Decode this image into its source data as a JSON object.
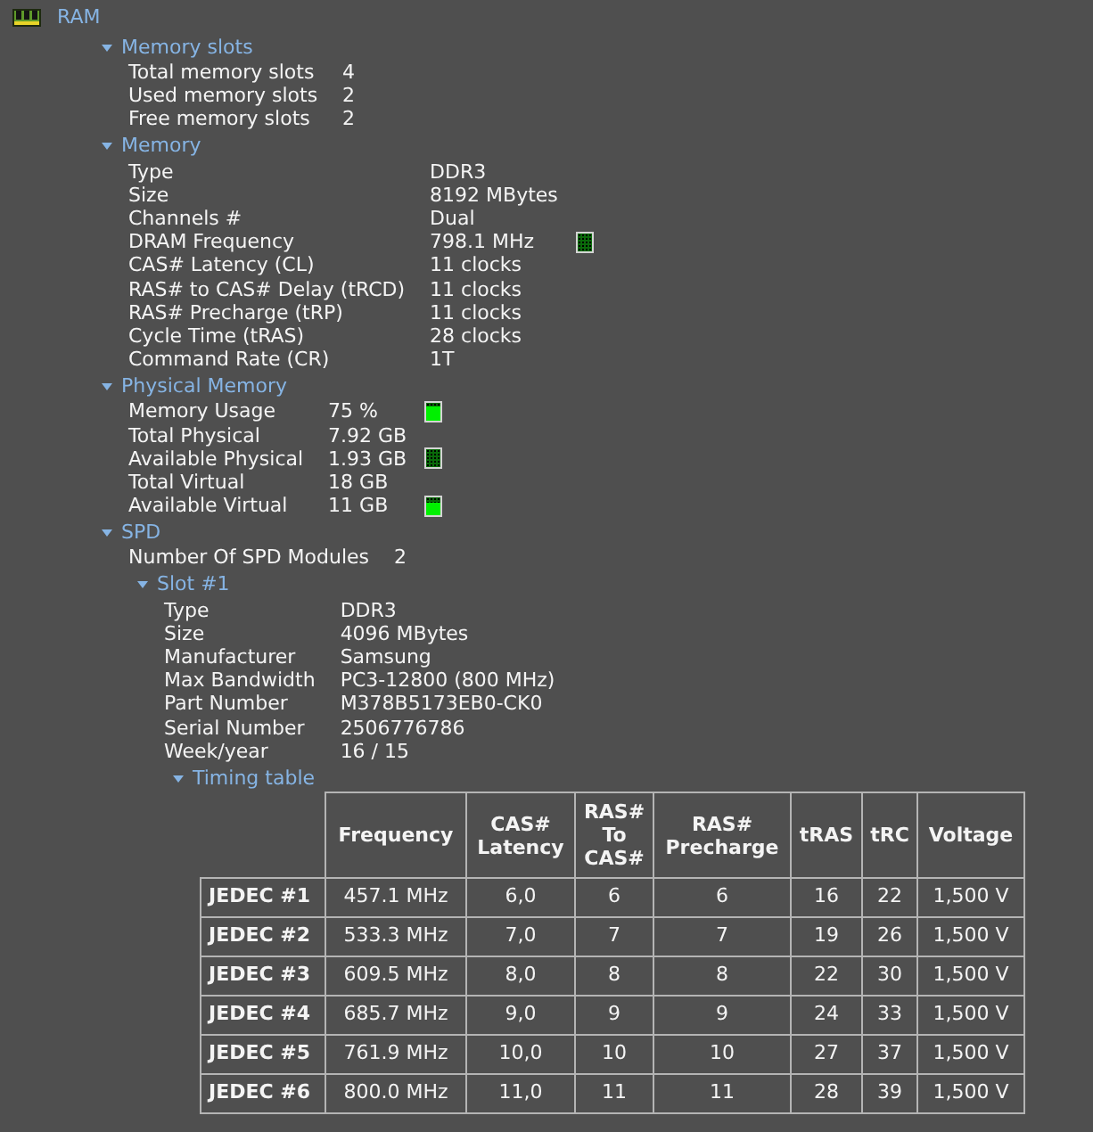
{
  "tree": {
    "label": "RAM",
    "sections": [
      {
        "title": "Memory slots",
        "expanded": true,
        "rows": [
          {
            "label": "Total memory slots",
            "value": "4"
          },
          {
            "label": "Used memory slots",
            "value": "2"
          },
          {
            "label": "Free memory slots",
            "value": "2"
          }
        ]
      },
      {
        "title": "Memory",
        "expanded": true,
        "rows": [
          {
            "label": "Type",
            "value": "DDR3"
          },
          {
            "label": "Size",
            "value": "8192 MBytes"
          },
          {
            "label": "Channels #",
            "value": "Dual"
          },
          {
            "label": "DRAM Frequency",
            "value": "798.1 MHz",
            "indicator": true
          },
          {
            "label": "CAS# Latency (CL)",
            "value": "11 clocks"
          },
          {
            "label": "RAS# to CAS# Delay (tRCD)",
            "value": "11 clocks"
          },
          {
            "label": "RAS# Precharge (tRP)",
            "value": "11 clocks"
          },
          {
            "label": "Cycle Time (tRAS)",
            "value": "28 clocks"
          },
          {
            "label": "Command Rate (CR)",
            "value": "1T"
          }
        ]
      },
      {
        "title": "Physical Memory",
        "expanded": true,
        "rows": [
          {
            "label": "Memory Usage",
            "value": "75 %",
            "meter": {
              "level": 0.8
            }
          },
          {
            "label": "Total Physical",
            "value": "7.92 GB"
          },
          {
            "label": "Available Physical",
            "value": "1.93 GB",
            "indicator": true
          },
          {
            "label": "Total Virtual",
            "value": "18 GB"
          },
          {
            "label": "Available Virtual",
            "value": "11 GB",
            "meter": {
              "level": 0.7
            }
          }
        ]
      },
      {
        "title": "SPD",
        "expanded": true,
        "rows": [
          {
            "label": "Number Of SPD Modules",
            "value": "2"
          }
        ],
        "children": [
          {
            "title": "Slot #1",
            "expanded": true,
            "rows": [
              {
                "label": "Type",
                "value": "DDR3"
              },
              {
                "label": "Size",
                "value": "4096 MBytes"
              },
              {
                "label": "Manufacturer",
                "value": "Samsung"
              },
              {
                "label": "Max Bandwidth",
                "value": "PC3-12800 (800 MHz)"
              },
              {
                "label": "Part Number",
                "value": "M378B5173EB0-CK0"
              },
              {
                "label": "Serial Number",
                "value": "2506776786"
              },
              {
                "label": "Week/year",
                "value": "16 / 15"
              }
            ],
            "children": [
              {
                "title": "Timing table",
                "expanded": true,
                "table": {
                  "columns": [
                    "Frequency",
                    "CAS# Latency",
                    "RAS# To CAS#",
                    "RAS# Precharge",
                    "tRAS",
                    "tRC",
                    "Voltage"
                  ],
                  "rows": [
                    {
                      "label": "JEDEC #1",
                      "cells": [
                        "457.1 MHz",
                        "6,0",
                        "6",
                        "6",
                        "16",
                        "22",
                        "1,500 V"
                      ]
                    },
                    {
                      "label": "JEDEC #2",
                      "cells": [
                        "533.3 MHz",
                        "7,0",
                        "7",
                        "7",
                        "19",
                        "26",
                        "1,500 V"
                      ]
                    },
                    {
                      "label": "JEDEC #3",
                      "cells": [
                        "609.5 MHz",
                        "8,0",
                        "8",
                        "8",
                        "22",
                        "30",
                        "1,500 V"
                      ]
                    },
                    {
                      "label": "JEDEC #4",
                      "cells": [
                        "685.7 MHz",
                        "9,0",
                        "9",
                        "9",
                        "24",
                        "33",
                        "1,500 V"
                      ]
                    },
                    {
                      "label": "JEDEC #5",
                      "cells": [
                        "761.9 MHz",
                        "10,0",
                        "10",
                        "10",
                        "27",
                        "37",
                        "1,500 V"
                      ]
                    },
                    {
                      "label": "JEDEC #6",
                      "cells": [
                        "800.0 MHz",
                        "11,0",
                        "11",
                        "11",
                        "28",
                        "39",
                        "1,500 V"
                      ]
                    }
                  ]
                }
              }
            ]
          }
        ]
      }
    ]
  }
}
